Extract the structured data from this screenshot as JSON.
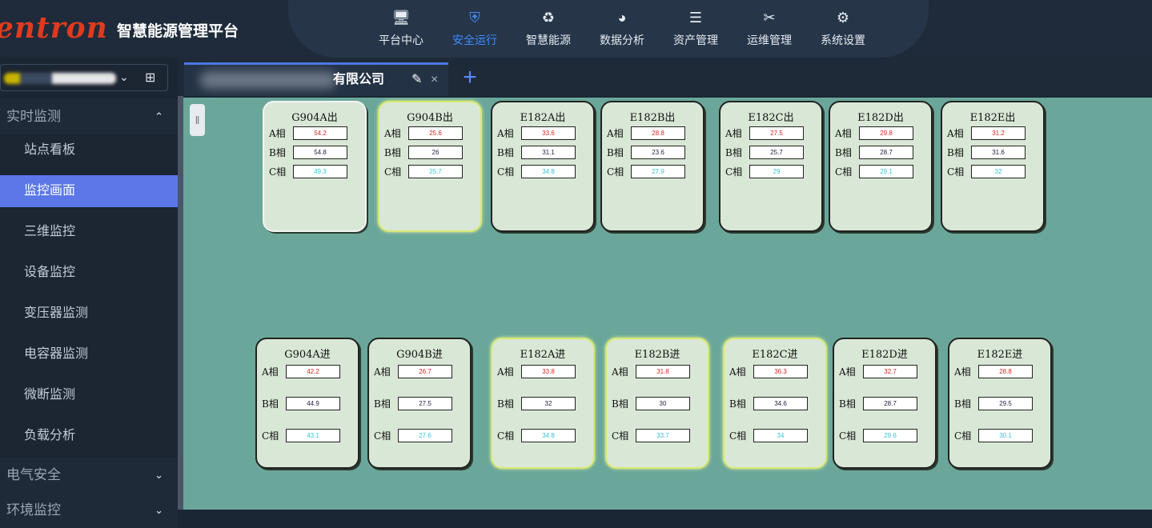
{
  "header": {
    "logo_text": "entron",
    "platform_title": "智慧能源管理平台",
    "nav": [
      {
        "label": "平台中心",
        "icon": "monitor-icon",
        "active": false
      },
      {
        "label": "安全运行",
        "icon": "shield-icon",
        "active": true
      },
      {
        "label": "智慧能源",
        "icon": "recycle-icon",
        "active": false
      },
      {
        "label": "数据分析",
        "icon": "pie-chart-icon",
        "active": false
      },
      {
        "label": "资产管理",
        "icon": "database-icon",
        "active": false
      },
      {
        "label": "运维管理",
        "icon": "tools-icon",
        "active": false
      },
      {
        "label": "系统设置",
        "icon": "gear-icon",
        "active": false
      }
    ]
  },
  "sidebar": {
    "groups": [
      {
        "label": "实时监测",
        "expanded": true
      },
      {
        "label": "电气安全",
        "expanded": false
      },
      {
        "label": "环境监控",
        "expanded": false
      }
    ],
    "items": [
      {
        "label": "站点看板",
        "active": false
      },
      {
        "label": "监控画面",
        "active": true
      },
      {
        "label": "三维监控",
        "active": false
      },
      {
        "label": "设备监控",
        "active": false
      },
      {
        "label": "变压器监测",
        "active": false
      },
      {
        "label": "电容器监测",
        "active": false
      },
      {
        "label": "微断监测",
        "active": false
      },
      {
        "label": "负载分析",
        "active": false
      }
    ]
  },
  "tab": {
    "label": "有限公司",
    "edit_icon": "✎",
    "close_icon": "×",
    "add_icon": "+"
  },
  "panels": [
    {
      "title": "G904A出",
      "a": "54.2",
      "b": "54.8",
      "c": "49.3"
    },
    {
      "title": "G904B出",
      "a": "25.6",
      "b": "26",
      "c": "25.7"
    },
    {
      "title": "E182A出",
      "a": "33.6",
      "b": "31.1",
      "c": "34.8"
    },
    {
      "title": "E182B出",
      "a": "28.8",
      "b": "23.6",
      "c": "27.9"
    },
    {
      "title": "E182C出",
      "a": "27.5",
      "b": "25.7",
      "c": "29"
    },
    {
      "title": "E182D出",
      "a": "29.8",
      "b": "28.7",
      "c": "29.1"
    },
    {
      "title": "E182E出",
      "a": "31.2",
      "b": "31.6",
      "c": "32"
    },
    {
      "title": "G904A进",
      "a": "42.2",
      "b": "44.9",
      "c": "43.1"
    },
    {
      "title": "G904B进",
      "a": "26.7",
      "b": "27.5",
      "c": "27.6"
    },
    {
      "title": "E182A进",
      "a": "33.8",
      "b": "32",
      "c": "34.8"
    },
    {
      "title": "E182B进",
      "a": "31.8",
      "b": "30",
      "c": "33.7"
    },
    {
      "title": "E182C进",
      "a": "36.3",
      "b": "34.6",
      "c": "34"
    },
    {
      "title": "E182D进",
      "a": "32.7",
      "b": "28.7",
      "c": "29.6"
    },
    {
      "title": "E182E进",
      "a": "28.8",
      "b": "29.5",
      "c": "30.1"
    }
  ],
  "phase_labels": {
    "a": "A相",
    "b": "B相",
    "c": "C相"
  }
}
